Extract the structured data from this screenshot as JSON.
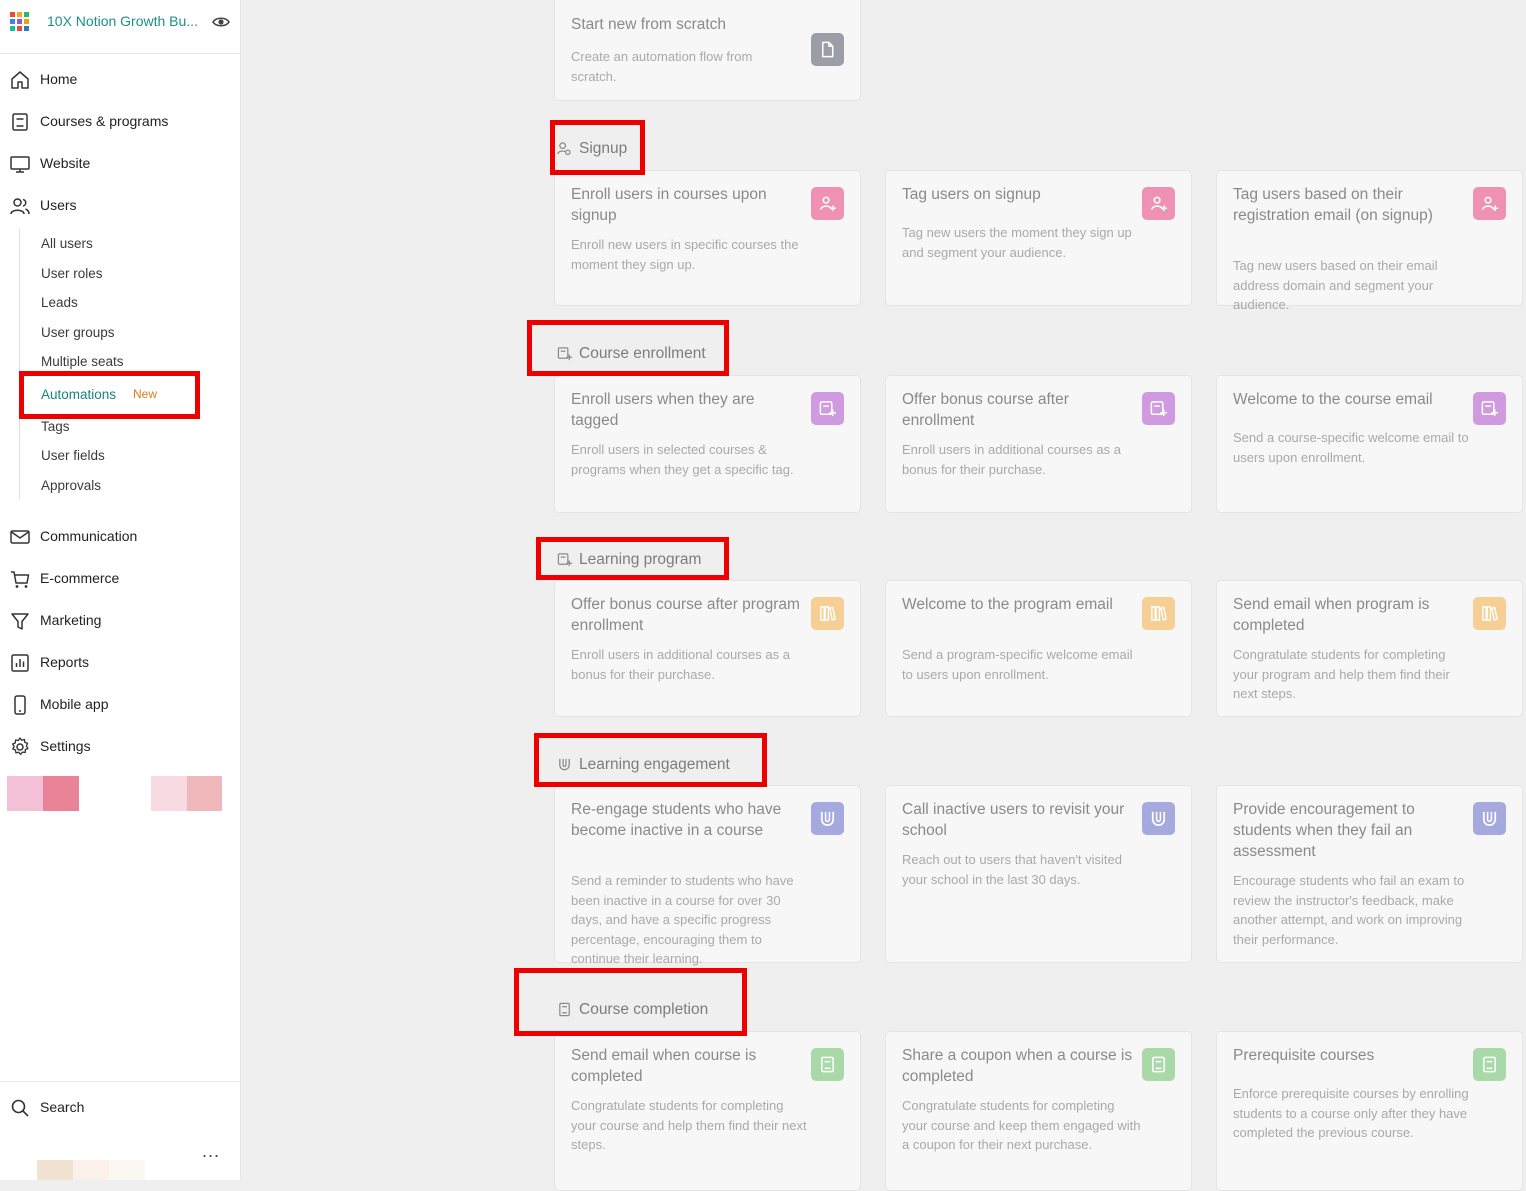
{
  "brand": {
    "name": "10X Notion Growth Bu...",
    "logo_icon": "app-grid-logo",
    "view_icon": "eye-icon"
  },
  "sidebar": {
    "nav_top": [
      {
        "label": "Home",
        "icon": "home-icon"
      },
      {
        "label": "Courses & programs",
        "icon": "book-icon"
      },
      {
        "label": "Website",
        "icon": "monitor-icon"
      },
      {
        "label": "Users",
        "icon": "users-icon"
      }
    ],
    "users_sub": [
      {
        "label": "All users"
      },
      {
        "label": "User roles"
      },
      {
        "label": "Leads"
      },
      {
        "label": "User groups"
      },
      {
        "label": "Multiple seats"
      },
      {
        "label": "Automations",
        "badge": "New",
        "active": true
      },
      {
        "label": "Tags"
      },
      {
        "label": "User fields"
      },
      {
        "label": "Approvals"
      }
    ],
    "nav_bottom": [
      {
        "label": "Communication",
        "icon": "mail-icon"
      },
      {
        "label": "E-commerce",
        "icon": "cart-icon"
      },
      {
        "label": "Marketing",
        "icon": "funnel-icon"
      },
      {
        "label": "Reports",
        "icon": "chart-icon"
      },
      {
        "label": "Mobile app",
        "icon": "phone-icon"
      },
      {
        "label": "Settings",
        "icon": "gear-icon"
      }
    ],
    "search_label": "Search",
    "more_label": "...",
    "swatch_colors": [
      "#f4c0d8",
      "#e98398",
      "#f8dbe2",
      "#f1b8bb"
    ],
    "avatar_colors": [
      "#f2e2d2",
      "#fbf1ea",
      "#fbf7f3"
    ]
  },
  "colors": {
    "accent": "#1e8f86",
    "badge": "#e07b1f",
    "highlight": "#ee0000",
    "icon_scratch": "#9a9ea7",
    "icon_signup": "#ee91b2",
    "icon_enrollment": "#cf9adf",
    "icon_program": "#f5cf94",
    "icon_engagement": "#a6a9de",
    "icon_completion": "#a9d9a9"
  },
  "scratch": {
    "title": "Start new from scratch",
    "desc": "Create an automation flow from scratch.",
    "icon": "file-icon"
  },
  "sections": [
    {
      "label": "Signup",
      "icon": "user-key-icon",
      "cards": [
        {
          "title": "Enroll users in courses upon signup",
          "desc": "Enroll new users in specific courses the moment they sign up.",
          "icon": "user-plus-icon"
        },
        {
          "title": "Tag users on signup",
          "desc": "Tag new users the moment they sign up and segment your audience.",
          "icon": "user-plus-icon"
        },
        {
          "title": "Tag users based on their registration email (on signup)",
          "desc": "Tag new users based on their email address domain and segment your audience.",
          "icon": "user-plus-icon"
        }
      ]
    },
    {
      "label": "Course enrollment",
      "icon": "enroll-icon",
      "cards": [
        {
          "title": "Enroll users when they are tagged",
          "desc": "Enroll users in selected courses & programs when they get a specific tag.",
          "icon": "enroll-icon"
        },
        {
          "title": "Offer bonus course after enrollment",
          "desc": "Enroll users in additional courses as a bonus for their purchase.",
          "icon": "enroll-icon"
        },
        {
          "title": "Welcome to the course email",
          "desc": "Send a course-specific welcome email to users upon enrollment.",
          "icon": "enroll-icon"
        }
      ]
    },
    {
      "label": "Learning program",
      "icon": "enroll-icon",
      "cards": [
        {
          "title": "Offer bonus course after program enrollment",
          "desc": "Enroll users in additional courses as a bonus for their purchase.",
          "icon": "books-icon"
        },
        {
          "title": "Welcome to the program email",
          "desc": "Send a program-specific welcome email to users upon enrollment.",
          "icon": "books-icon"
        },
        {
          "title": "Send email when program is completed",
          "desc": "Congratulate students for completing your program and help them find their next steps.",
          "icon": "books-icon"
        }
      ]
    },
    {
      "label": "Learning engagement",
      "icon": "magnet-icon",
      "cards": [
        {
          "title": "Re-engage students who have become inactive in a course",
          "desc": "Send a reminder to students who have been inactive in a course for over 30 days, and have a specific progress percentage, encouraging them to continue their learning.",
          "icon": "magnet-icon"
        },
        {
          "title": "Call inactive users to revisit your school",
          "desc": "Reach out to users that haven't visited your school in the last 30 days.",
          "icon": "magnet-icon"
        },
        {
          "title": "Provide encouragement to students when they fail an assessment",
          "desc": "Encourage students who fail an exam to review the instructor's feedback, make another attempt, and work on improving their performance.",
          "icon": "magnet-icon"
        }
      ]
    },
    {
      "label": "Course completion",
      "icon": "notebook-icon",
      "cards": [
        {
          "title": "Send email when course is completed",
          "desc": "Congratulate students for completing your course and help them find their next steps.",
          "icon": "notebook-icon"
        },
        {
          "title": "Share a coupon when a course is completed",
          "desc": "Congratulate students for completing your course and keep them engaged with a coupon for their next purchase.",
          "icon": "notebook-icon"
        },
        {
          "title": "Prerequisite courses",
          "desc": "Enforce prerequisite courses by enrolling students to a course only after they have completed the previous course.",
          "icon": "notebook-icon"
        }
      ]
    }
  ]
}
